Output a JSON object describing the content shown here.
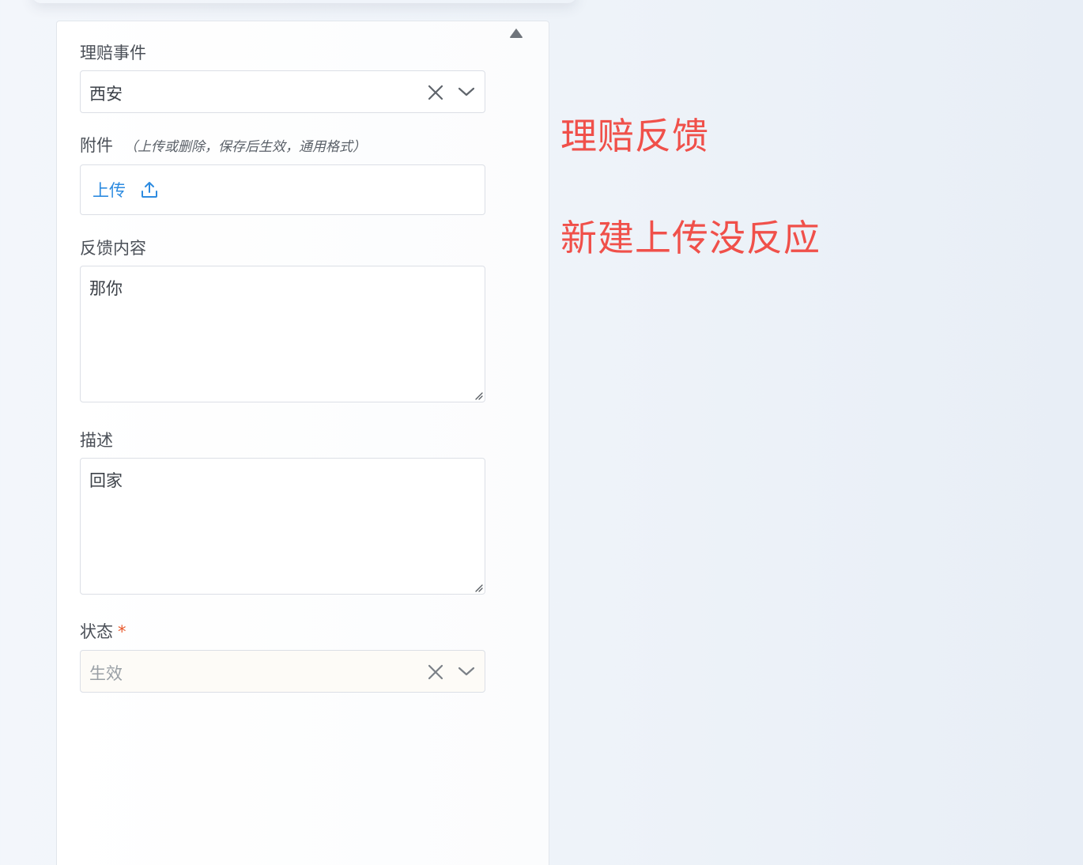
{
  "form": {
    "claim_event": {
      "label": "理赔事件",
      "value": "西安"
    },
    "attachment": {
      "label": "附件",
      "hint": "（上传或删除，保存后生效，通用格式）",
      "upload_label": "上传"
    },
    "feedback": {
      "label": "反馈内容",
      "value": "那你"
    },
    "description": {
      "label": "描述",
      "value": "回家"
    },
    "status": {
      "label": "状态",
      "required_mark": "*",
      "value": "生效"
    }
  },
  "annotations": {
    "title": "理赔反馈",
    "issue": "新建上传没反应"
  },
  "colors": {
    "accent": "#2d8be0",
    "required": "#e8592c",
    "annotation": "#f0504a"
  },
  "icons": {
    "collapse": "triangle-up-icon",
    "clear": "close-icon",
    "dropdown": "chevron-down-icon",
    "upload": "upload-icon",
    "resize": "resize-handle-icon"
  }
}
